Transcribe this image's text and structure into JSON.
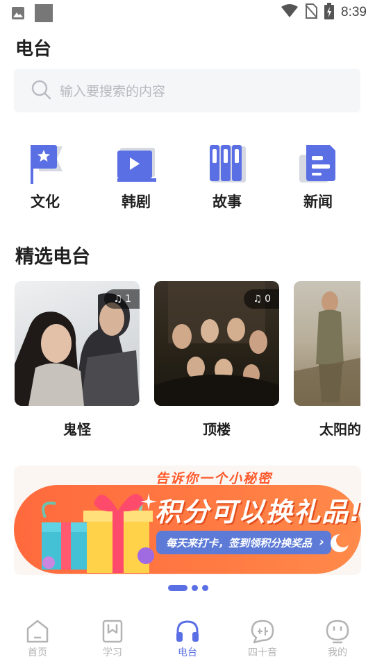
{
  "status_bar": {
    "time": "8:39"
  },
  "page": {
    "title": "电台"
  },
  "search": {
    "placeholder": "输入要搜索的内容"
  },
  "categories": [
    {
      "label": "文化",
      "icon": "flag-star-icon"
    },
    {
      "label": "韩剧",
      "icon": "video-screen-icon"
    },
    {
      "label": "故事",
      "icon": "books-icon"
    },
    {
      "label": "新闻",
      "icon": "newspaper-icon"
    }
  ],
  "featured": {
    "title": "精选电台",
    "items": [
      {
        "name": "鬼怪",
        "play_count": "1"
      },
      {
        "name": "顶楼",
        "play_count": "0"
      },
      {
        "name": "太阳的"
      }
    ]
  },
  "banner": {
    "top_text": "告诉你一个小秘密",
    "main_text": "积分可以换礼品!",
    "sub_text": "每天来打卡，签到领积分换奖品"
  },
  "carousel": {
    "pages": 3,
    "active": 0
  },
  "tabbar": {
    "items": [
      {
        "label": "首页",
        "icon": "home-icon"
      },
      {
        "label": "学习",
        "icon": "bookmark-icon"
      },
      {
        "label": "电台",
        "icon": "headphones-icon",
        "active": true
      },
      {
        "label": "四十音",
        "icon": "chat-bubble-icon"
      },
      {
        "label": "我的",
        "icon": "smiley-icon"
      }
    ]
  },
  "colors": {
    "accent": "#5b6fe4",
    "banner_orange": "#ff6a3d"
  }
}
